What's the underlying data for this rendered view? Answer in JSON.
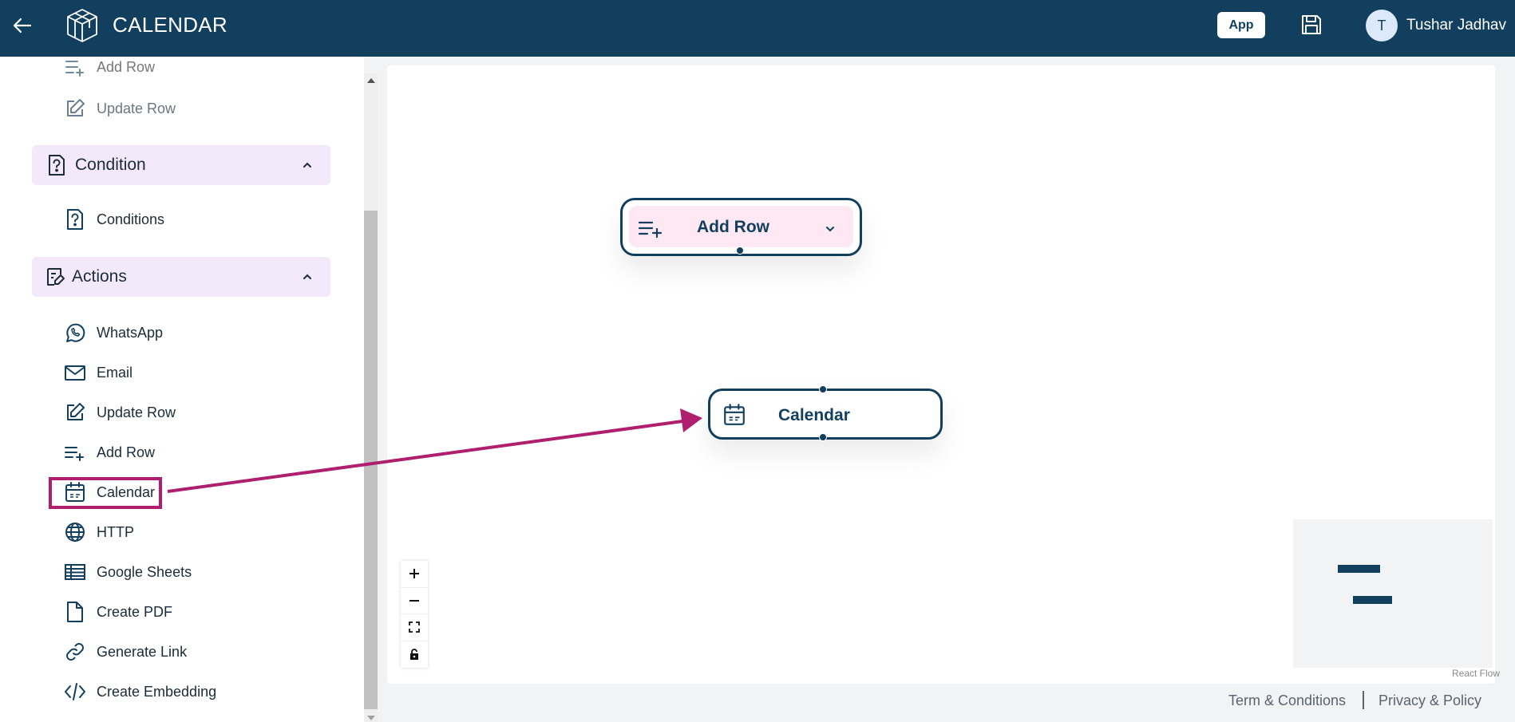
{
  "header": {
    "title": "CALENDAR",
    "app_button": "App",
    "user_initial": "T",
    "user_name": "Tushar Jadhav"
  },
  "sidebar": {
    "top_items": [
      {
        "label": "Add Row",
        "icon": "add-row-icon"
      },
      {
        "label": "Update Row",
        "icon": "edit-icon"
      }
    ],
    "sections": [
      {
        "title": "Condition",
        "icon": "question-icon",
        "items": [
          {
            "label": "Conditions",
            "icon": "question-icon"
          }
        ]
      },
      {
        "title": "Actions",
        "icon": "actions-icon",
        "items": [
          {
            "label": "WhatsApp",
            "icon": "whatsapp-icon"
          },
          {
            "label": "Email",
            "icon": "mail-icon"
          },
          {
            "label": "Update Row",
            "icon": "edit-icon"
          },
          {
            "label": "Add Row",
            "icon": "add-row-icon"
          },
          {
            "label": "Calendar",
            "icon": "calendar-icon"
          },
          {
            "label": "HTTP",
            "icon": "globe-icon"
          },
          {
            "label": "Google Sheets",
            "icon": "sheet-icon"
          },
          {
            "label": "Create PDF",
            "icon": "file-icon"
          },
          {
            "label": "Generate Link",
            "icon": "link-icon"
          },
          {
            "label": "Create Embedding",
            "icon": "code-icon"
          }
        ]
      }
    ]
  },
  "canvas": {
    "nodes": [
      {
        "label": "Add Row",
        "icon": "add-row-icon"
      },
      {
        "label": "Calendar",
        "icon": "calendar-icon"
      }
    ],
    "attribution": "React Flow"
  },
  "footer": {
    "terms": "Term & Conditions",
    "privacy": "Privacy & Policy"
  },
  "colors": {
    "header_bg": "#133f5f",
    "section_bg": "#f4e8fb",
    "node_highlight_bg": "#fde8f4",
    "annotation": "#b01e6e"
  }
}
